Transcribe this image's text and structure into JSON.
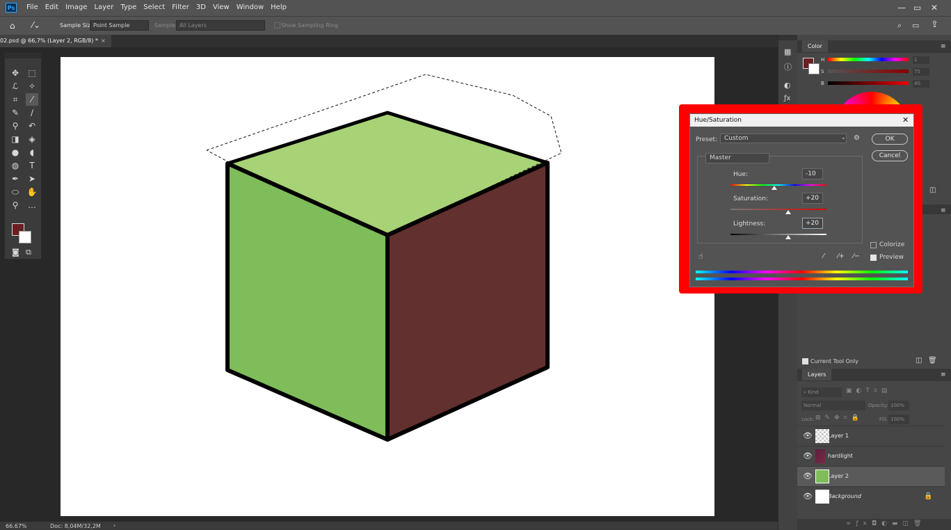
{
  "app": {
    "logo_text": "Ps"
  },
  "menu": [
    "File",
    "Edit",
    "Image",
    "Layer",
    "Type",
    "Select",
    "Filter",
    "3D",
    "View",
    "Window",
    "Help"
  ],
  "options_bar": {
    "sample_size_label": "Sample Size:",
    "sample_size_value": "Point Sample",
    "sample_label": "Sample:",
    "sample_value": "All Layers",
    "show_ring_label": "Show Sampling Ring"
  },
  "document": {
    "tab_title": "02.psd @ 66,7% (Layer 2, RGB/8) *",
    "close_glyph": "×"
  },
  "status": {
    "zoom": "66.67%",
    "doc": "Doc: 8,04M/32,2M",
    "arrow": "›"
  },
  "color_panel": {
    "title": "Color",
    "labels": [
      "H",
      "S",
      "B"
    ],
    "values": [
      "1",
      "75",
      "40"
    ]
  },
  "tool_preset_panel": {
    "current_tool_only": "Current Tool Only"
  },
  "layers_panel": {
    "title": "Layers",
    "kind_placeholder": "Kind",
    "blend_mode": "Normal",
    "opacity_label": "Opacity:",
    "opacity_value": "100%",
    "lock_label": "Lock:",
    "fill_label": "Fill:",
    "fill_value": "100%",
    "layers": [
      {
        "name": "Layer 1"
      },
      {
        "name": "hardlight"
      },
      {
        "name": "Layer 2"
      },
      {
        "name": "Background"
      }
    ]
  },
  "dialog": {
    "title": "Hue/Saturation",
    "preset_label": "Preset:",
    "preset_value": "Custom",
    "ok": "OK",
    "cancel": "Cancel",
    "channel": "Master",
    "hue_label": "Hue:",
    "hue_value": "-10",
    "saturation_label": "Saturation:",
    "saturation_value": "+20",
    "lightness_label": "Lightness:",
    "lightness_value": "+20",
    "colorize_label": "Colorize",
    "preview_label": "Preview"
  },
  "colors": {
    "foreground": "#6b1f22",
    "background": "#ffffff",
    "cube_left": "#7fbc5a",
    "cube_top": "#a8d276",
    "cube_right": "#62302e",
    "highlight": "#ff0000"
  }
}
